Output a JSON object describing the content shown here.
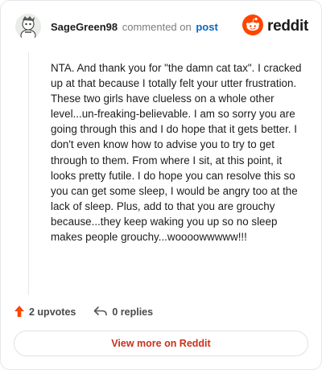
{
  "comment": {
    "author": "SageGreen98",
    "verb": "commented on",
    "post_link": "post",
    "avatar_icon": "snoo-avatar-icon",
    "body": "NTA. And thank you for \"the damn cat tax\". I cracked up at that because I totally felt your utter frustration. These two girls have clueless on a whole other level...un-freaking-believable. I am so sorry you are going through this and I do hope that it gets better. I don't even know how to advise you to try to get through to them. From where I sit, at this point, it looks pretty futile. I do hope you can resolve this so you can get some sleep, I would be angry too at the lack of sleep. Plus, add to that you are grouchy because...they keep waking you up so no sleep makes people grouchy...woooowwwww!!!"
  },
  "brand": {
    "name": "reddit",
    "logo_icon": "reddit-snoo-icon",
    "color": "#ff4500"
  },
  "actions": {
    "upvotes": "2 upvotes",
    "upvote_icon": "upvote-arrow-icon",
    "upvote_color": "#ff4500",
    "replies": "0 replies",
    "reply_icon": "reply-arrow-icon"
  },
  "footer": {
    "view_more": "View more on Reddit",
    "accent": "#c8311b"
  }
}
